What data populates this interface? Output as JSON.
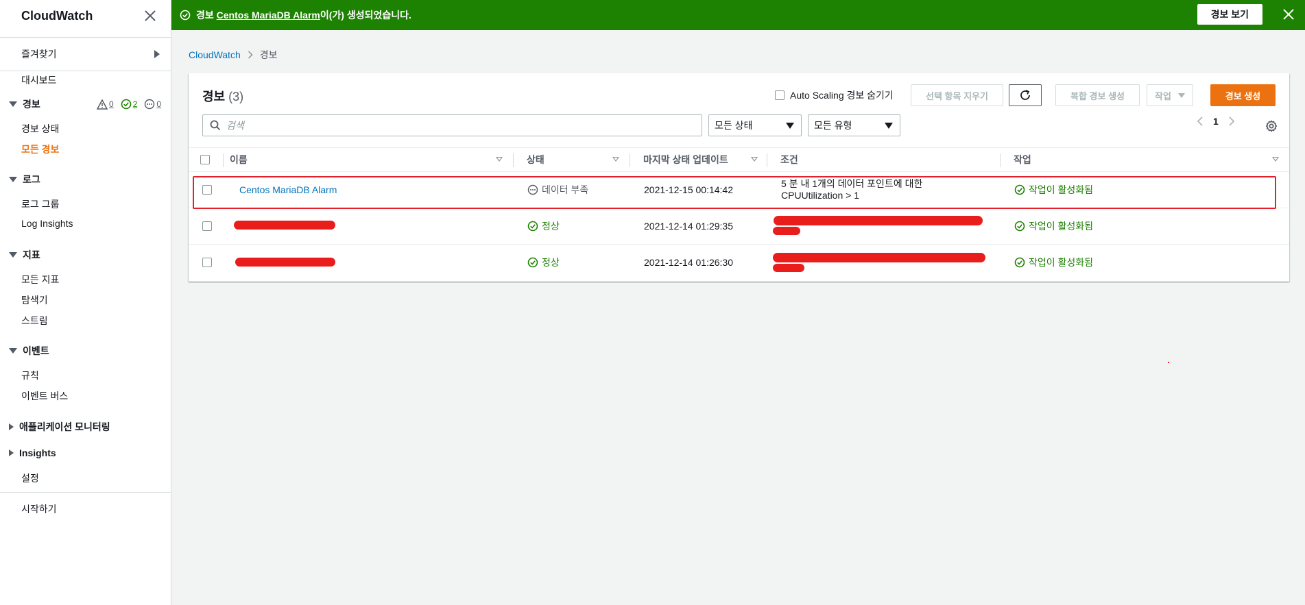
{
  "sidebar": {
    "title": "CloudWatch",
    "favorites": "즐겨찾기",
    "dashboard": "대시보드",
    "alarms": {
      "label": "경보",
      "counts": {
        "alarm": "0",
        "ok": "2",
        "insufficient": "0"
      },
      "items": [
        "경보 상태",
        "모든 경보"
      ]
    },
    "logs": {
      "label": "로그",
      "items": [
        "로그 그룹",
        "Log Insights"
      ]
    },
    "metrics": {
      "label": "지표",
      "items": [
        "모든 지표",
        "탐색기",
        "스트림"
      ]
    },
    "events": {
      "label": "이벤트",
      "items": [
        "규칙",
        "이벤트 버스"
      ]
    },
    "app_monitoring": "애플리케이션 모니터링",
    "insights": "Insights",
    "settings": "설정",
    "getting_started": "시작하기"
  },
  "flash": {
    "prefix": "경보 ",
    "link": "Centos MariaDB Alarm",
    "suffix": "이(가) 생성되었습니다.",
    "button": "경보 보기"
  },
  "breadcrumb": {
    "root": "CloudWatch",
    "current": "경보"
  },
  "panel": {
    "title": "경보",
    "count": "(3)",
    "hide_asg": "Auto Scaling 경보 숨기기",
    "clear_selection": "선택 항목 지우기",
    "create_composite": "복합 경보 생성",
    "actions": "작업",
    "create_alarm": "경보 생성",
    "search_placeholder": "검색",
    "state_filter": "모든 상태",
    "type_filter": "모든 유형",
    "page": "1"
  },
  "table": {
    "headers": {
      "name": "이름",
      "state": "상태",
      "updated": "마지막 상태 업데이트",
      "conditions": "조건",
      "actions": "작업"
    },
    "rows": [
      {
        "name": "Centos MariaDB Alarm",
        "state": "데이터 부족",
        "state_type": "insufficient",
        "updated": "2021-12-15 00:14:42",
        "conditions": "5 분 내 1개의 데이터 포인트에 대한 CPUUtilization > 1",
        "actions": "작업이 활성화됨"
      },
      {
        "name": "",
        "state": "정상",
        "state_type": "ok",
        "updated": "2021-12-14 01:29:35",
        "conditions": "",
        "actions": "작업이 활성화됨"
      },
      {
        "name": "",
        "state": "정상",
        "state_type": "ok",
        "updated": "2021-12-14 01:26:30",
        "conditions": "",
        "actions": "작업이 활성화됨"
      }
    ]
  },
  "colors": {
    "success": "#1d8102",
    "primary": "#ec7211",
    "link": "#0073bb",
    "highlight": "#e4202b"
  }
}
